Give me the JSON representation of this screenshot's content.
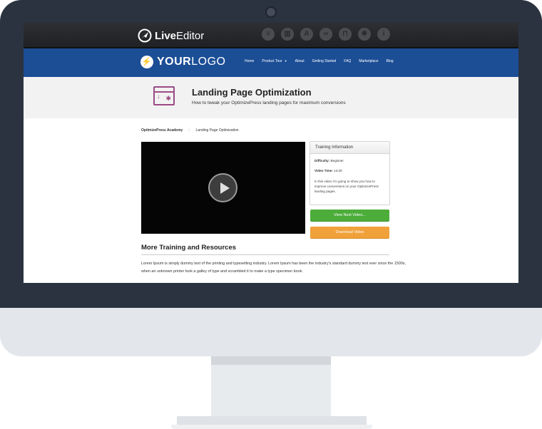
{
  "toolbar": {
    "brand_live": "Live",
    "brand_editor": "Editor",
    "tools": [
      {
        "icon": "layers-icon",
        "glyph": "≡"
      },
      {
        "icon": "columns-icon",
        "glyph": "▥"
      },
      {
        "icon": "typography-icon",
        "glyph": "A"
      },
      {
        "icon": "link-icon",
        "glyph": "∞"
      },
      {
        "icon": "lock-icon",
        "glyph": "⊓"
      },
      {
        "icon": "settings-icon",
        "glyph": "✱"
      },
      {
        "icon": "info-icon",
        "glyph": "i"
      }
    ]
  },
  "site": {
    "logo_your": "YOUR",
    "logo_logo": "LOGO",
    "nav": [
      "Home",
      "Product Tour",
      "About",
      "Getting Started",
      "FAQ",
      "Marketplace",
      "Blog"
    ]
  },
  "hero": {
    "title": "Landing Page Optimization",
    "subtitle": "How to tweak your OptimizePress landing pages for maximum conversions"
  },
  "breadcrumb": {
    "home": "OptimizePress Academy",
    "current": "Landing Page Optimization"
  },
  "training": {
    "heading": "Training Information",
    "difficulty_label": "Difficulty:",
    "difficulty_value": "Beginner",
    "time_label": "Video Time:",
    "time_value": "14:20",
    "description": "In this video I'm going to show you how to improve conversions on your OptimizePress landing pages."
  },
  "buttons": {
    "next": "View Next Video...",
    "download": "Download Video"
  },
  "more": {
    "title": "More Training and Resources",
    "text": "Lorem Ipsum is simply dummy text of the printing and typesetting industry. Lorem Ipsum has been the industry's standard dummy text ever since the 1500s, when an unknown printer took a galley of type and scrambled it to make a type specimen book."
  },
  "colors": {
    "nav_blue": "#1c4e96",
    "accent_purple": "#9a4a84",
    "green": "#4cad3a",
    "orange": "#f0a13a",
    "bezel": "#2b3340"
  }
}
